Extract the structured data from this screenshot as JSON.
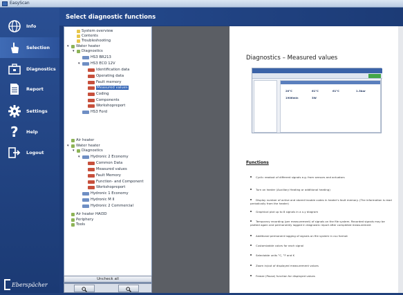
{
  "window": {
    "title": "EasyScan"
  },
  "header": {
    "title": "Select diagnostic functions"
  },
  "sidebar": {
    "items": [
      {
        "label": "Info",
        "icon": "globe-icon"
      },
      {
        "label": "Selection",
        "icon": "hand-pointer-icon",
        "selected": true
      },
      {
        "label": "Diagnostics",
        "icon": "toolbox-icon"
      },
      {
        "label": "Report",
        "icon": "document-icon"
      },
      {
        "label": "Settings",
        "icon": "gear-icon"
      },
      {
        "label": "Help",
        "icon": "question-icon"
      },
      {
        "label": "Logout",
        "icon": "logout-icon"
      }
    ],
    "brand": "Eberspächer"
  },
  "tree": [
    "System overview",
    "Contents",
    "Troubleshooting",
    "Water heater",
    "Diagnostics",
    "HS3 BR213",
    "HS3 ECO 12V",
    "Identification data",
    "Operating data",
    "Fault memory",
    "Measured values",
    "Coding",
    "Components",
    "Workshopreport",
    "HS3 Ford",
    "Air heater",
    "Water heater",
    "Diagnostics",
    "Hydronic 2 Economy",
    "Common Data",
    "Measured values",
    "Fault Memory",
    "Function- and Component",
    "Workshopreport",
    "Hydronic 1 Economy",
    "Hydronic M II",
    "Hydronic 2 Commercial",
    "Air heater HAI3D",
    "Periphery",
    "Tools"
  ],
  "buttons": {
    "uncheck_all": "Uncheck all"
  },
  "doc": {
    "title": "Diagnostics – Measured values",
    "functions_heading": "Functions",
    "functions": [
      "Cyclic readout of different signals e.g. from sensors and actuators",
      "Turn on heater (Auxiliary Heating or additional heating)",
      "Display number of active and stored trouble codes in heater's fault memory. (The information is read periodically from the heater)",
      "Graphical plot up to 8 signals in a x-y diagram",
      "Temporary recording (per measurement) of signals on the file system. Recorded signals may be plotted again and permanently logged in diagnostic report after completed measurement",
      "Additional permanent logging of signals on file system in csv format",
      "Customizable colors for each signal",
      "Selectable units °C, °F and K",
      "Zoom in/out of displayed measurement values",
      "Freeze (Pause) function for displayed values"
    ],
    "shot_values": [
      "20°C",
      "61°C",
      "61°C",
      "1.3bar",
      "1906min",
      "3W"
    ]
  }
}
